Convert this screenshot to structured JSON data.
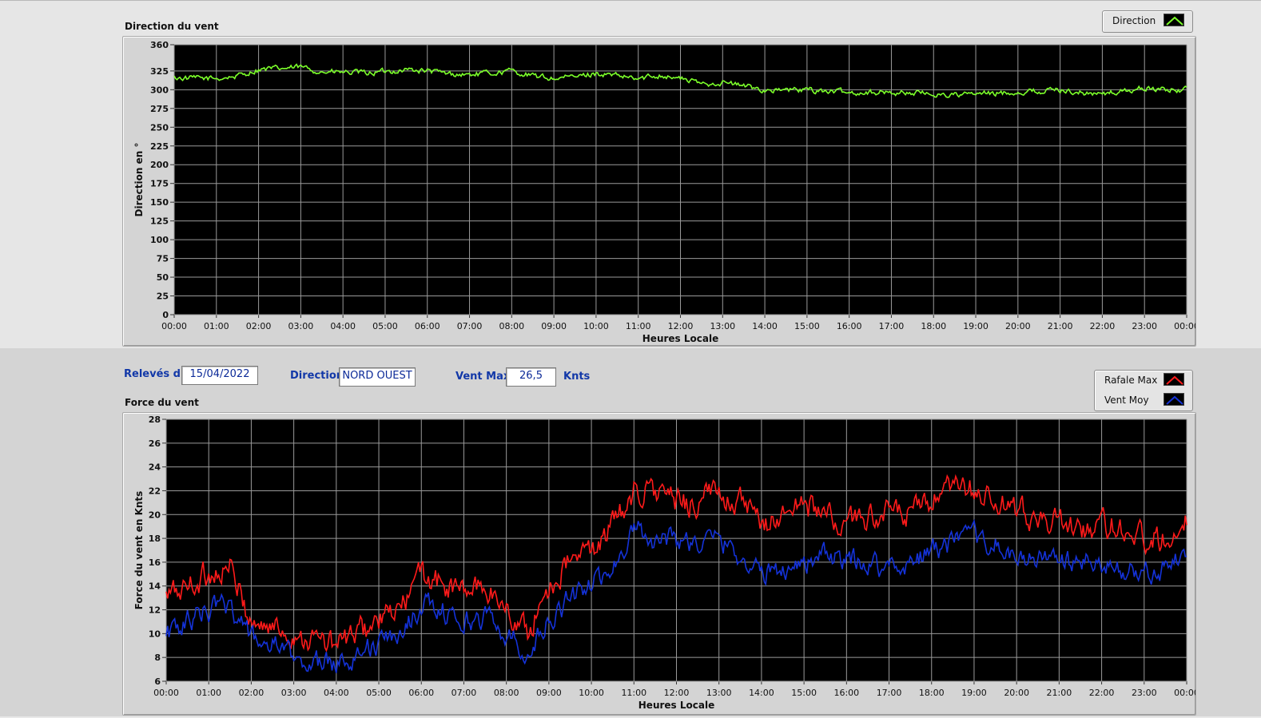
{
  "chart_data": [
    {
      "type": "line",
      "title": "Direction du vent",
      "xlabel": "Heures Locale",
      "ylabel": "Direction en °",
      "ylim": [
        0,
        360
      ],
      "yticks": [
        0,
        25,
        50,
        75,
        100,
        125,
        150,
        175,
        200,
        225,
        250,
        275,
        300,
        325,
        360
      ],
      "xticks": [
        "00:00",
        "01:00",
        "02:00",
        "03:00",
        "04:00",
        "05:00",
        "06:00",
        "07:00",
        "08:00",
        "09:00",
        "10:00",
        "11:00",
        "12:00",
        "13:00",
        "14:00",
        "15:00",
        "16:00",
        "17:00",
        "18:00",
        "19:00",
        "20:00",
        "21:00",
        "22:00",
        "23:00",
        "00:00"
      ],
      "xlim_hours": [
        0,
        24
      ],
      "grid": true,
      "legend": "top-right",
      "series": [
        {
          "name": "Direction",
          "color": "#7cff2a",
          "x_hours": [
            0,
            0.5,
            1,
            1.5,
            2,
            2.5,
            3,
            3.5,
            4,
            4.5,
            5,
            5.5,
            6,
            6.5,
            7,
            7.5,
            8,
            8.5,
            9,
            9.5,
            10,
            10.5,
            11,
            11.5,
            12,
            12.5,
            13,
            13.5,
            14,
            14.5,
            15,
            15.5,
            16,
            16.5,
            17,
            17.5,
            18,
            18.5,
            19,
            19.5,
            20,
            20.5,
            21,
            21.5,
            22,
            22.5,
            23,
            23.5,
            24
          ],
          "values": [
            316,
            315,
            315,
            318,
            327,
            328,
            330,
            324,
            323,
            322,
            324,
            327,
            325,
            321,
            320,
            322,
            325,
            318,
            315,
            317,
            322,
            318,
            314,
            320,
            315,
            308,
            310,
            305,
            300,
            299,
            300,
            298,
            296,
            297,
            296,
            296,
            294,
            293,
            294,
            295,
            297,
            298,
            300,
            296,
            294,
            298,
            302,
            300,
            300
          ],
          "noise": 4
        }
      ]
    },
    {
      "type": "line",
      "title": "Force du vent",
      "xlabel": "Heures Locale",
      "ylabel": "Force du vent en Knts",
      "ylim": [
        6,
        28
      ],
      "yticks": [
        6,
        8,
        10,
        12,
        14,
        16,
        18,
        20,
        22,
        24,
        26,
        28
      ],
      "xticks": [
        "00:00",
        "01:00",
        "02:00",
        "03:00",
        "04:00",
        "05:00",
        "06:00",
        "07:00",
        "08:00",
        "09:00",
        "10:00",
        "11:00",
        "12:00",
        "13:00",
        "14:00",
        "15:00",
        "16:00",
        "17:00",
        "18:00",
        "19:00",
        "20:00",
        "21:00",
        "22:00",
        "23:00",
        "00:00"
      ],
      "xlim_hours": [
        0,
        24
      ],
      "grid": true,
      "legend": "top-right",
      "series": [
        {
          "name": "Rafale Max",
          "color": "#ff1a1a",
          "x_hours": [
            0,
            0.5,
            1,
            1.5,
            2,
            2.5,
            3,
            3.5,
            4,
            4.5,
            5,
            5.5,
            6,
            6.5,
            7,
            7.5,
            8,
            8.5,
            9,
            9.5,
            10,
            10.5,
            11,
            11.5,
            12,
            12.5,
            13,
            13.5,
            14,
            14.5,
            15,
            15.5,
            16,
            16.5,
            17,
            17.5,
            18,
            18.5,
            19,
            19.5,
            20,
            20.5,
            21,
            21.5,
            22,
            22.5,
            23,
            23.5,
            24
          ],
          "values": [
            13,
            14,
            15,
            15.5,
            11,
            10.5,
            10,
            9.5,
            9,
            10,
            11,
            12,
            15,
            14,
            13.5,
            14,
            12,
            10,
            14,
            16,
            17,
            19,
            22,
            22,
            21,
            21,
            22,
            21,
            19,
            20,
            21,
            20,
            19,
            20,
            20,
            20,
            21,
            22,
            22,
            21,
            20,
            20,
            19,
            19,
            19,
            19,
            18,
            18,
            20
          ],
          "noise": 1.2
        },
        {
          "name": "Vent Moy",
          "color": "#1432d8",
          "x_hours": [
            0,
            0.5,
            1,
            1.5,
            2,
            2.5,
            3,
            3.5,
            4,
            4.5,
            5,
            5.5,
            6,
            6.5,
            7,
            7.5,
            8,
            8.5,
            9,
            9.5,
            10,
            10.5,
            11,
            11.5,
            12,
            12.5,
            13,
            13.5,
            14,
            14.5,
            15,
            15.5,
            16,
            16.5,
            17,
            17.5,
            18,
            18.5,
            19,
            19.5,
            20,
            20.5,
            21,
            21.5,
            22,
            22.5,
            23,
            23.5,
            24
          ],
          "values": [
            10,
            11,
            12,
            12.5,
            9.5,
            9,
            8,
            7.5,
            7.5,
            8.5,
            9,
            10,
            12.5,
            12,
            11,
            11.5,
            10,
            8.5,
            11,
            13,
            14,
            15.5,
            19,
            18,
            18,
            17.5,
            18,
            16.5,
            15,
            15.5,
            16,
            16.5,
            16,
            16,
            15.5,
            16,
            17,
            17.5,
            18,
            17.5,
            16,
            16.5,
            16,
            16,
            15.5,
            15.5,
            15,
            15.5,
            16.5
          ],
          "noise": 1
        }
      ]
    }
  ],
  "info": {
    "releves_label": "Relevés du",
    "releves_value": "15/04/2022",
    "direction_label": "Direction",
    "direction_value": "NORD OUEST",
    "ventmax_label": "Vent Max",
    "ventmax_value": "26,5",
    "ventmax_unit": "Knts"
  }
}
